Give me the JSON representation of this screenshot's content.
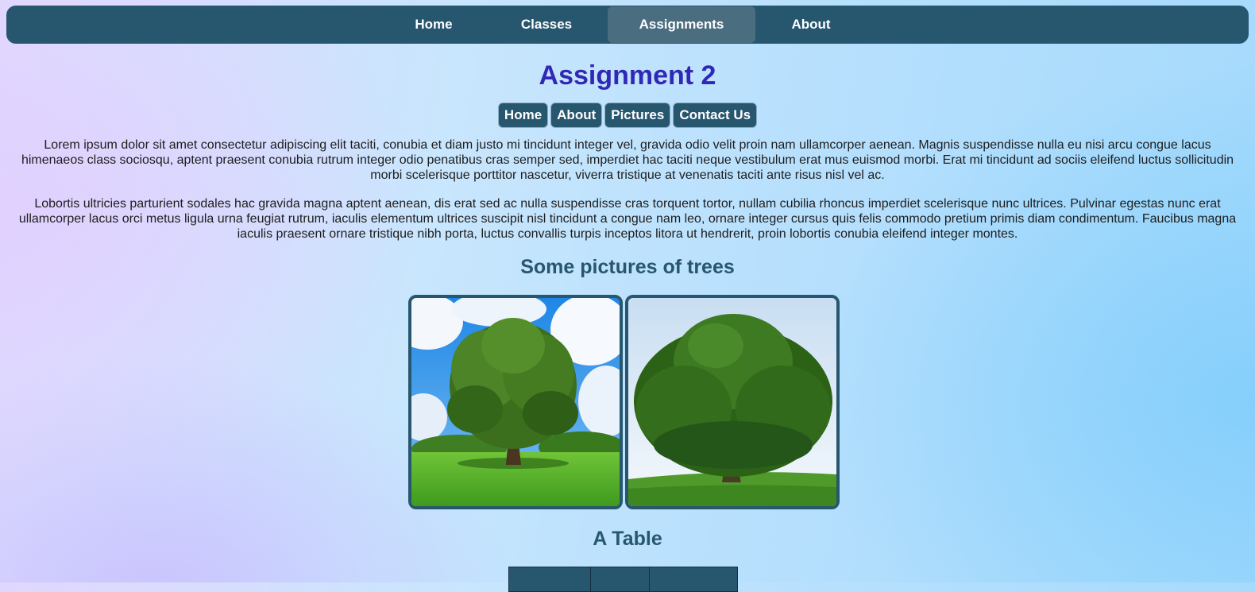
{
  "top_nav": {
    "items": [
      {
        "label": "Home"
      },
      {
        "label": "Classes"
      },
      {
        "label": "Assignments",
        "active": true
      },
      {
        "label": "About"
      }
    ]
  },
  "page": {
    "title": "Assignment 2",
    "sub_nav": [
      {
        "label": "Home"
      },
      {
        "label": "About"
      },
      {
        "label": "Pictures"
      },
      {
        "label": "Contact Us"
      }
    ],
    "paragraphs": [
      "Lorem ipsum dolor sit amet consectetur adipiscing elit taciti, conubia et diam justo mi tincidunt integer vel, gravida odio velit proin nam ullamcorper aenean. Magnis suspendisse nulla eu nisi arcu congue lacus himenaeos class sociosqu, aptent praesent conubia rutrum integer odio penatibus cras semper sed, imperdiet hac taciti neque vestibulum erat mus euismod morbi. Erat mi tincidunt ad sociis eleifend luctus sollicitudin morbi scelerisque porttitor nascetur, viverra tristique at venenatis taciti ante risus nisl vel ac.",
      "Lobortis ultricies parturient sodales hac gravida magna aptent aenean, dis erat sed ac nulla suspendisse cras torquent tortor, nullam cubilia rhoncus imperdiet scelerisque nunc ultrices. Pulvinar egestas nunc erat ullamcorper lacus orci metus ligula urna feugiat rutrum, iaculis elementum ultrices suscipit nisl tincidunt a congue nam leo, ornare integer cursus quis felis commodo pretium primis diam condimentum. Faucibus magna iaculis praesent ornare tristique nibh porta, luctus convallis turpis inceptos litora ut hendrerit, proin lobortis conubia eleifend integer montes."
    ],
    "trees_heading": "Some pictures of trees",
    "table_heading": "A Table"
  },
  "colors": {
    "nav_bg": "#27566f",
    "nav_active": "#4b6d80",
    "title": "#3128b5",
    "heading": "#27566f"
  }
}
